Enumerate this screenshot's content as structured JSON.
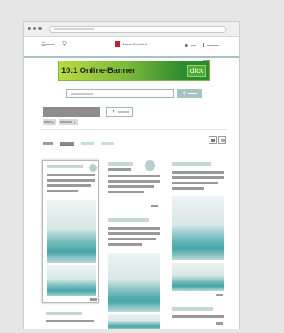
{
  "browser": {
    "title_dots": [
      "dot",
      "dot",
      "dot"
    ],
    "url_placeholder": ""
  },
  "header": {
    "logo_text": "Messe Frankfurt",
    "menu_icon": "hamburger-icon",
    "search_icon": "search-icon",
    "login_icon": "user-icon"
  },
  "banner": {
    "text": "10:1 Online-Banner",
    "cta": "click",
    "colors": {
      "start": "#b8dc41",
      "end": "#2e8a2f",
      "button": "#2d8d2e"
    }
  },
  "search": {
    "placeholder": "",
    "button_icon": "search-icon"
  },
  "filters": {
    "filter_icon": "filter-icon",
    "chips": [
      {
        "remove_icon": "close-icon"
      },
      {
        "remove_icon": "close-icon"
      }
    ]
  },
  "view_toggle": {
    "grid_icon": "grid-icon",
    "list_icon": "list-icon"
  },
  "accent_color": "#a4c3c3"
}
